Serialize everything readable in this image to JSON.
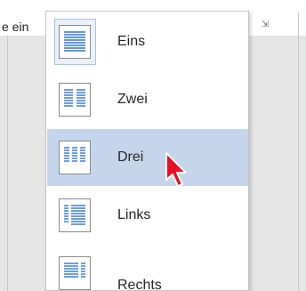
{
  "background": {
    "left_text": "e ein",
    "dialog_launcher_icon": "dialog-launcher-icon"
  },
  "menu": {
    "items": [
      {
        "label": "Eins",
        "icon": "columns-one-icon",
        "state": "selected"
      },
      {
        "label": "Zwei",
        "icon": "columns-two-icon",
        "state": "normal"
      },
      {
        "label": "Drei",
        "icon": "columns-three-icon",
        "state": "hover"
      },
      {
        "label": "Links",
        "icon": "columns-left-icon",
        "state": "normal"
      },
      {
        "label": "Rechts",
        "icon": "columns-right-icon",
        "state": "normal"
      }
    ]
  },
  "colors": {
    "hover_bg": "#c5d6ec",
    "selected_frame": "#a6c3e8",
    "icon_lines": "#2e75d6",
    "cursor": "#e81123"
  }
}
